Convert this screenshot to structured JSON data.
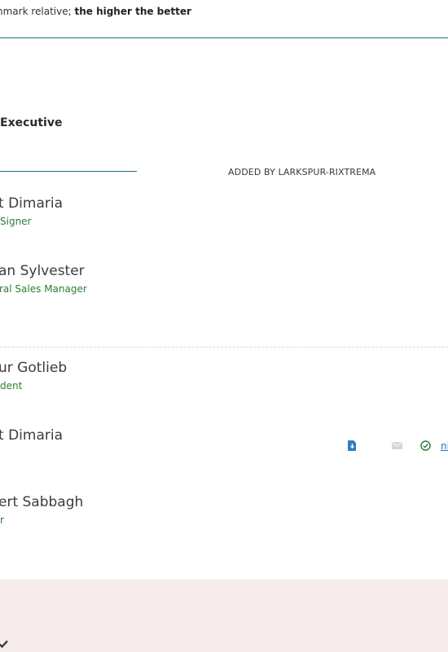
{
  "header": {
    "note_prefix": "nmark relative; ",
    "note_emphasis": "the higher the better"
  },
  "section": {
    "title": "Executive",
    "added_by": "ADDED BY LARKSPUR-RIXTREMA"
  },
  "contacts_group_1": [
    {
      "name": "t Dimaria",
      "role": "Signer"
    },
    {
      "name": "an Sylvester",
      "role": "ral Sales Manager"
    }
  ],
  "contacts_group_2": [
    {
      "name": "ur Gotlieb",
      "role": "dent"
    },
    {
      "name": "t Dimaria",
      "role": ""
    },
    {
      "name": "ert Sabbagh",
      "role": "r"
    }
  ],
  "actions": {
    "download_icon": "download-document-icon",
    "email_icon": "envelope-icon",
    "status_icon": "check-circle-icon",
    "link_text": "ni"
  },
  "colors": {
    "accent_rule": "#1e6e86",
    "role_green": "#2e7d32",
    "link_blue": "#1a73c9",
    "footer_bg": "#f4ebea"
  }
}
